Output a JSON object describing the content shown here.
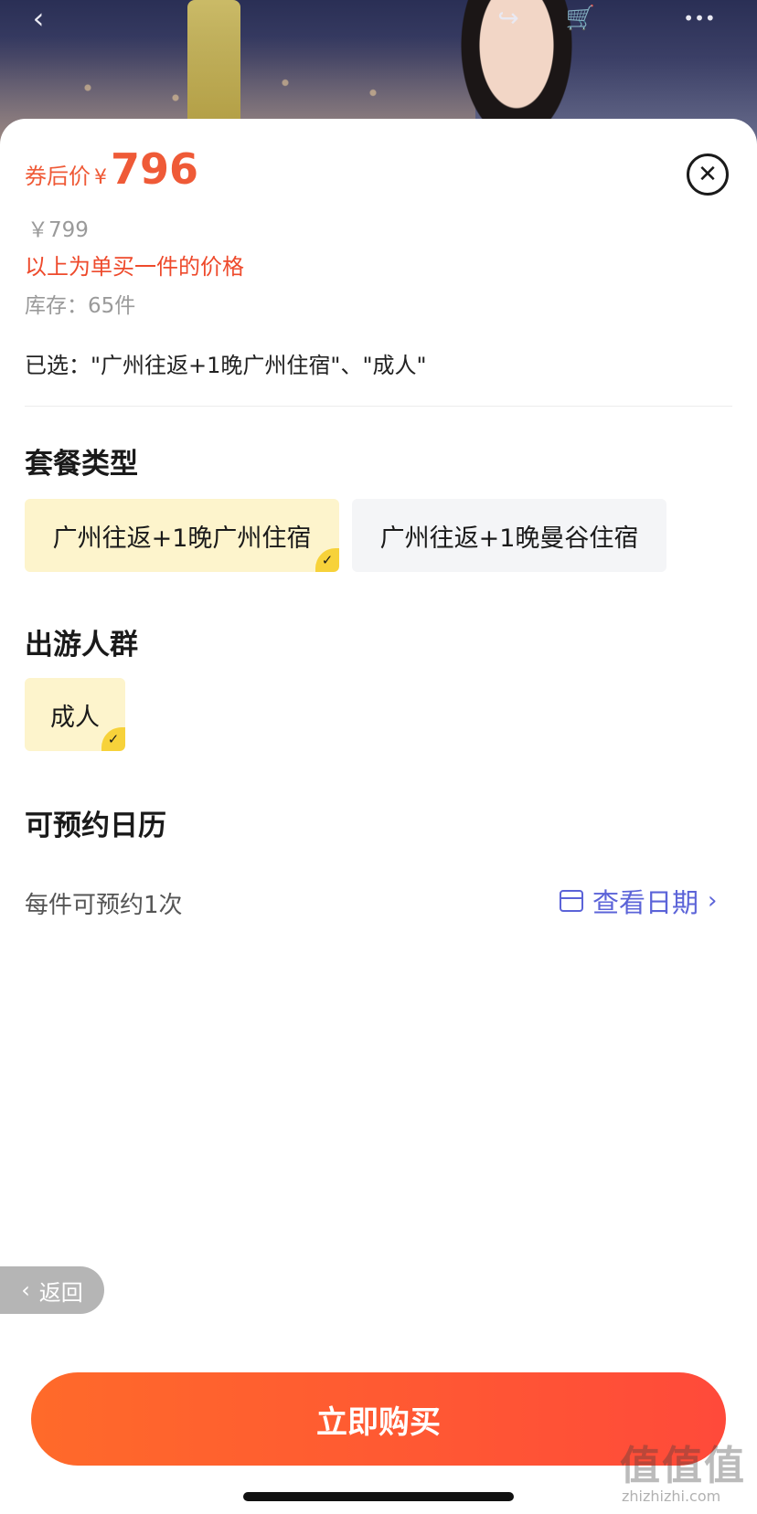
{
  "header": {
    "back_glyph": "‹",
    "share_glyph": "↪",
    "cart_glyph": "🛒",
    "more_glyph": "•••"
  },
  "price": {
    "label": "券后价",
    "currency": "¥",
    "value": "796",
    "original": "￥799",
    "note": "以上为单买一件的价格",
    "stock": "库存：65件"
  },
  "selected_text": "已选：\"广州往返+1晚广州住宿\"、\"成人\"",
  "close_glyph": "✕",
  "package": {
    "title": "套餐类型",
    "options": [
      {
        "label": "广州往返+1晚广州住宿",
        "selected": true
      },
      {
        "label": "广州往返+1晚曼谷住宿",
        "selected": false
      }
    ]
  },
  "crowd": {
    "title": "出游人群",
    "options": [
      {
        "label": "成人",
        "selected": true
      }
    ]
  },
  "calendar": {
    "title": "可预约日历",
    "note": "每件可预约1次",
    "link_label": "查看日期",
    "link_chevron": "›"
  },
  "back_pill": {
    "arrow": "‹",
    "label": "返回"
  },
  "buy_button": "立即购买",
  "check_glyph": "✓",
  "watermark": {
    "text": "值值值",
    "url": "zhizhizhi.com"
  },
  "colors": {
    "accent": "#ef5a37",
    "link": "#5b63d8",
    "selected_bg": "#fdf4cc",
    "check": "#f7d23a"
  }
}
